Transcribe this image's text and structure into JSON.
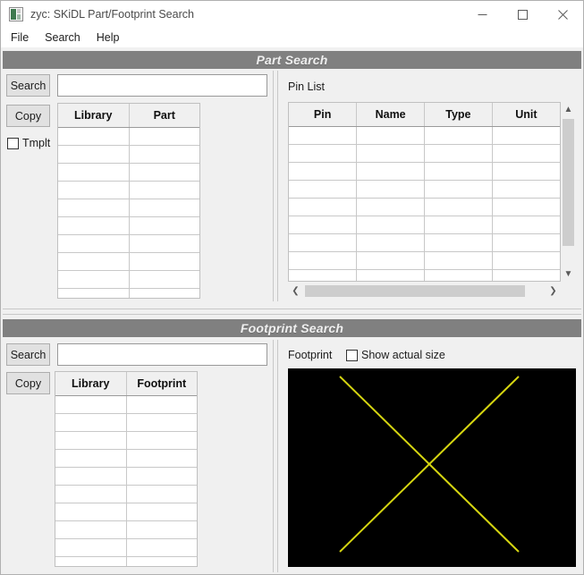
{
  "window": {
    "title": "zyc: SKiDL Part/Footprint Search",
    "icon": "app-icon",
    "controls": {
      "minimize": "minimize-icon",
      "maximize": "maximize-icon",
      "close": "close-icon"
    }
  },
  "menubar": {
    "items": [
      {
        "label": "File"
      },
      {
        "label": "Search"
      },
      {
        "label": "Help"
      }
    ]
  },
  "part_search": {
    "banner": "Part Search",
    "search_button": "Search",
    "copy_button": "Copy",
    "template_checkbox": {
      "label": "Tmplt",
      "checked": false
    },
    "search_input": {
      "value": "",
      "placeholder": ""
    },
    "results_table": {
      "columns": [
        "Library",
        "Part"
      ],
      "rows": [
        [
          "",
          ""
        ],
        [
          "",
          ""
        ],
        [
          "",
          ""
        ],
        [
          "",
          ""
        ],
        [
          "",
          ""
        ],
        [
          "",
          ""
        ],
        [
          "",
          ""
        ],
        [
          "",
          ""
        ],
        [
          "",
          ""
        ],
        [
          "",
          ""
        ]
      ]
    },
    "pin_list": {
      "label": "Pin List",
      "columns": [
        "Pin",
        "Name",
        "Type",
        "Unit"
      ],
      "rows": [
        [
          "",
          "",
          "",
          ""
        ],
        [
          "",
          "",
          "",
          ""
        ],
        [
          "",
          "",
          "",
          ""
        ],
        [
          "",
          "",
          "",
          ""
        ],
        [
          "",
          "",
          "",
          ""
        ],
        [
          "",
          "",
          "",
          ""
        ],
        [
          "",
          "",
          "",
          ""
        ],
        [
          "",
          "",
          "",
          ""
        ],
        [
          "",
          "",
          "",
          ""
        ]
      ],
      "scroll_up": "▲",
      "scroll_down": "▼",
      "scroll_left": "❮",
      "scroll_right": "❯"
    }
  },
  "footprint_search": {
    "banner": "Footprint Search",
    "search_button": "Search",
    "copy_button": "Copy",
    "search_input": {
      "value": "",
      "placeholder": ""
    },
    "results_table": {
      "columns": [
        "Library",
        "Footprint"
      ],
      "rows": [
        [
          "",
          ""
        ],
        [
          "",
          ""
        ],
        [
          "",
          ""
        ],
        [
          "",
          ""
        ],
        [
          "",
          ""
        ],
        [
          "",
          ""
        ],
        [
          "",
          ""
        ],
        [
          "",
          ""
        ],
        [
          "",
          ""
        ],
        [
          "",
          ""
        ]
      ]
    },
    "viewer": {
      "label": "Footprint",
      "actual_size_checkbox": {
        "label": "Show actual size",
        "checked": false
      },
      "background_color": "#000000",
      "graphic_color": "#d6d611",
      "graphic": "x-cross-placeholder"
    }
  }
}
